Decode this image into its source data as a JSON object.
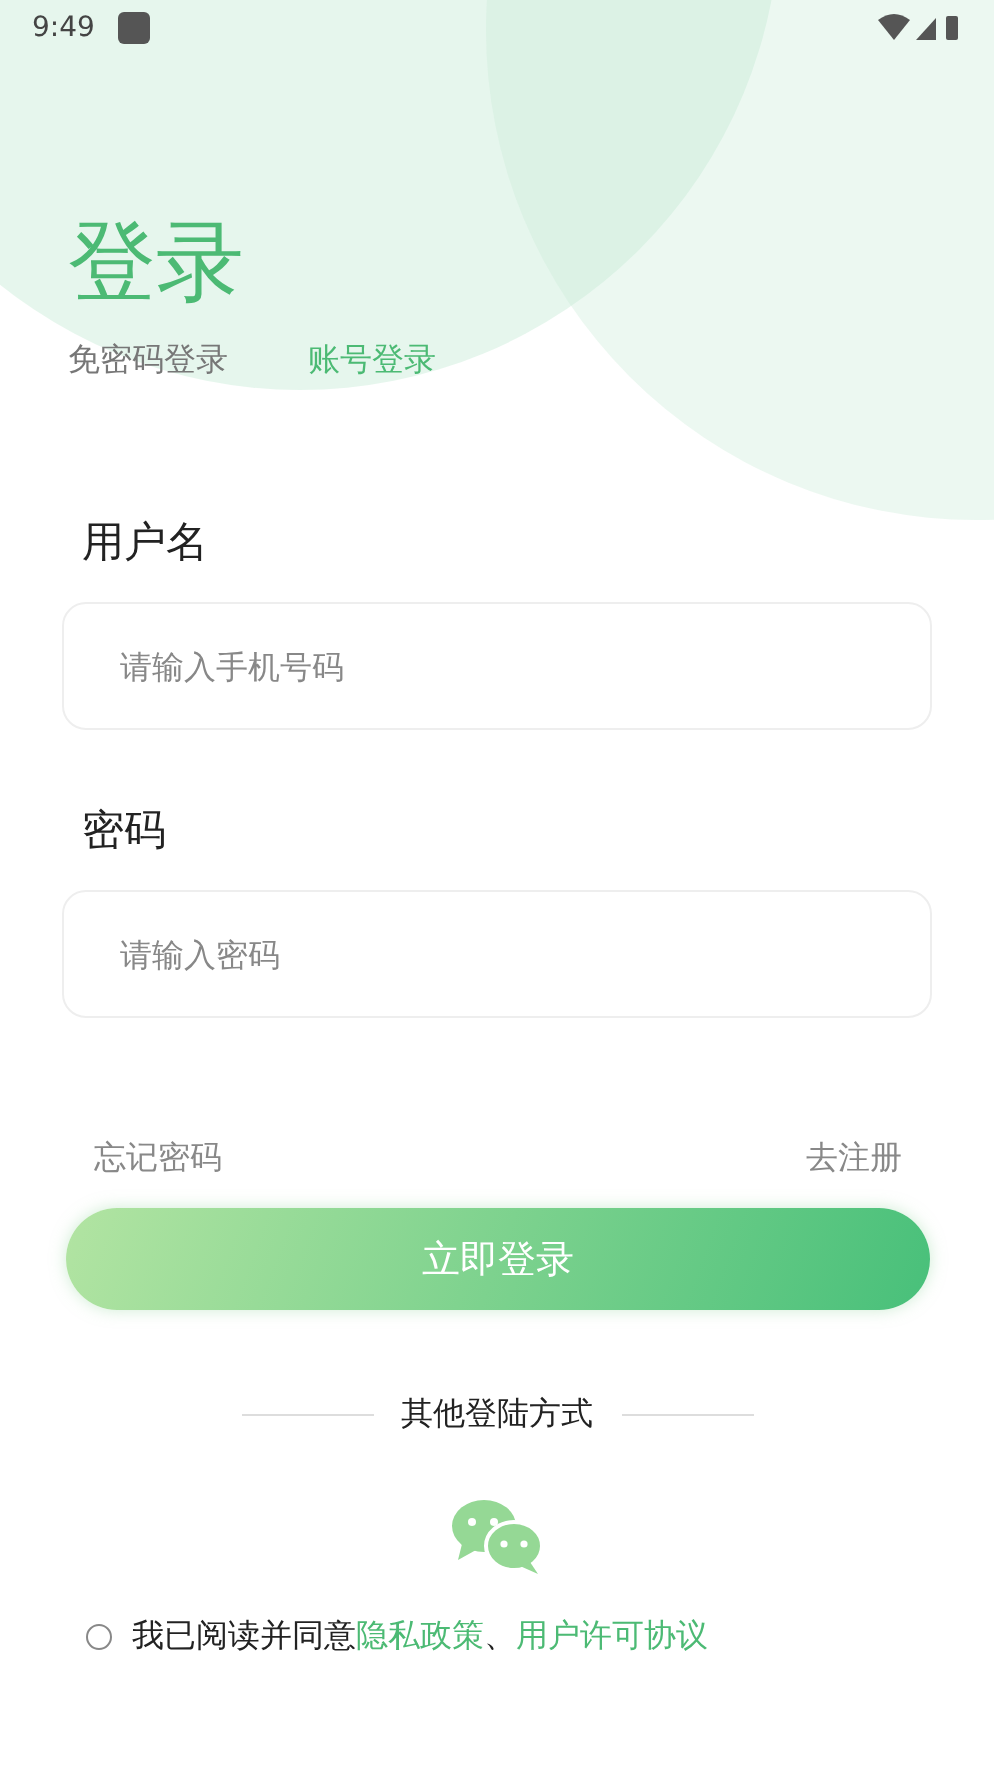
{
  "status_bar": {
    "time": "9:49"
  },
  "title": "登录",
  "tabs": [
    {
      "label": "免密码登录",
      "selected": false
    },
    {
      "label": "账号登录",
      "selected": true
    }
  ],
  "fields": [
    {
      "label": "用户名",
      "placeholder": "请输入手机号码"
    },
    {
      "label": "密码",
      "placeholder": "请输入密码"
    }
  ],
  "forgot_link": "忘记密码",
  "register_link": "去注册",
  "login_button": "立即登录",
  "other_methods": "其他登陆方式",
  "agreement": {
    "checked": false,
    "text": "我已阅读并同意",
    "links": [
      "隐私政策",
      "用户许可协议"
    ],
    "separator": "、"
  }
}
